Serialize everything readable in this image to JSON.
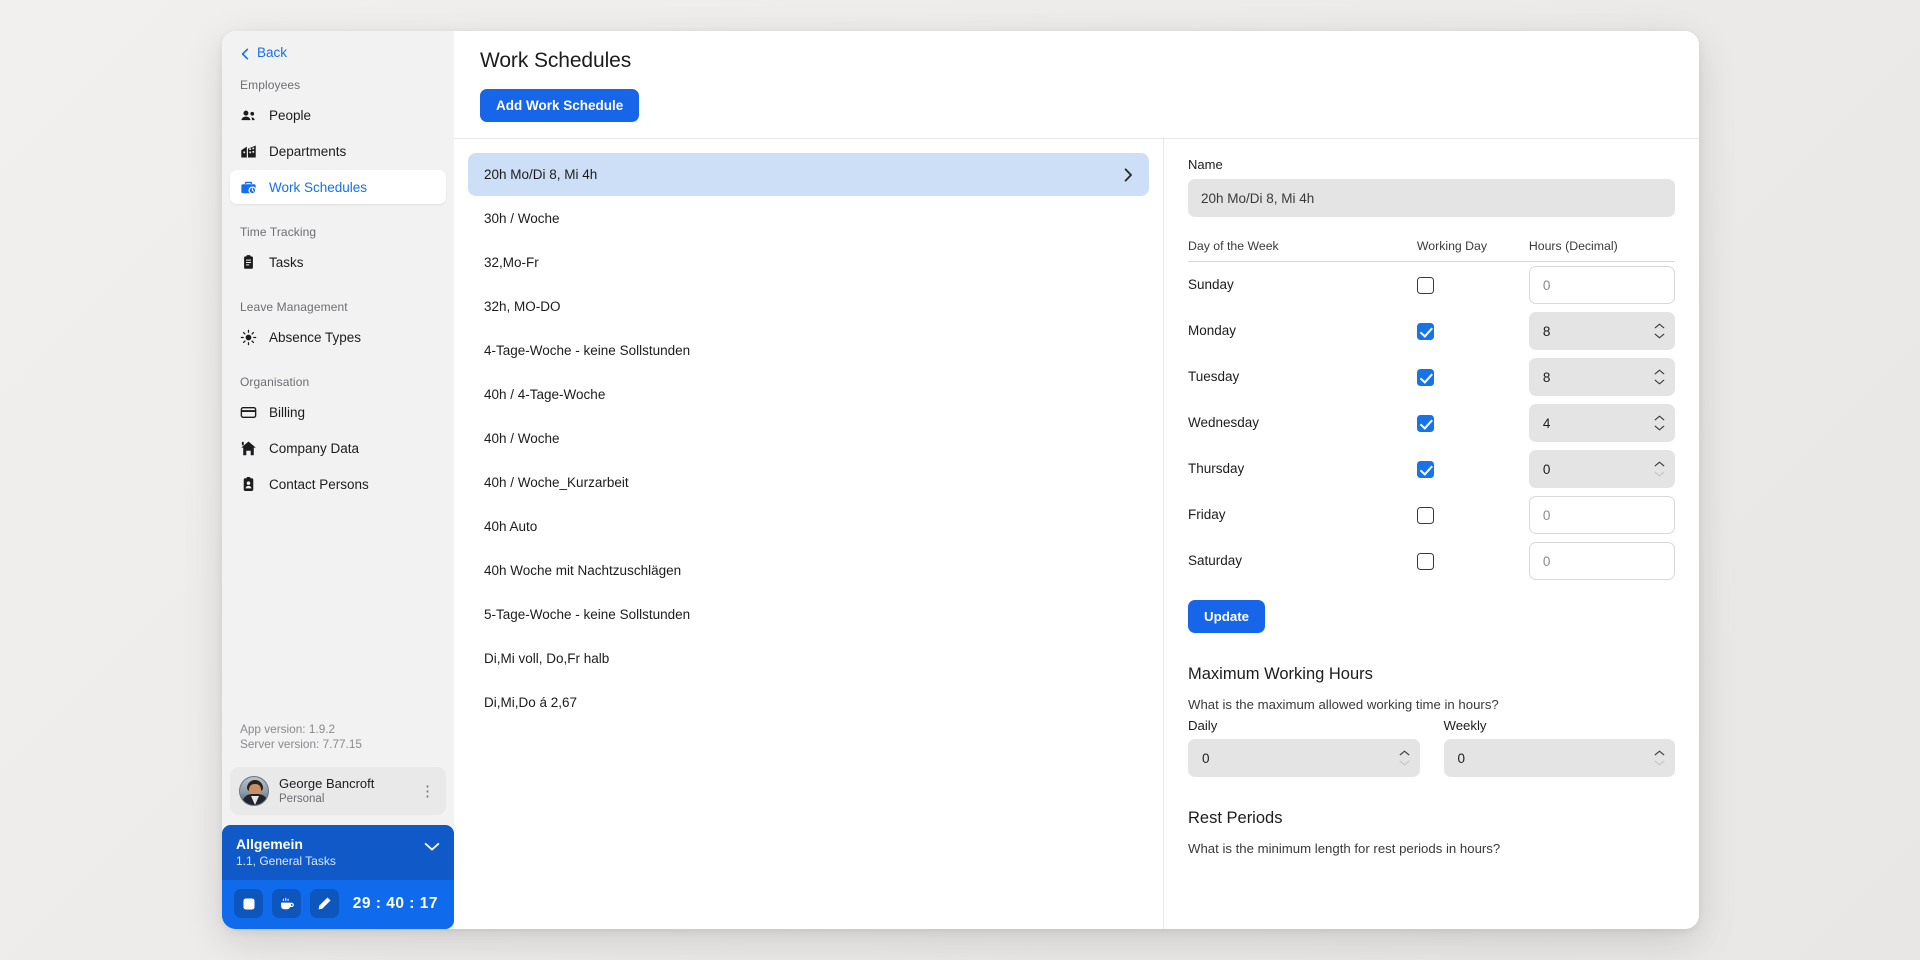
{
  "sidebar": {
    "back_label": "Back",
    "back_icon": "chevron-left-icon",
    "sections": [
      {
        "title": "Employees",
        "items": [
          {
            "label": "People",
            "icon": "people-icon",
            "active": false
          },
          {
            "label": "Departments",
            "icon": "department-building-icon",
            "active": false
          },
          {
            "label": "Work Schedules",
            "icon": "briefcase-clock-icon",
            "active": true
          }
        ]
      },
      {
        "title": "Time Tracking",
        "items": [
          {
            "label": "Tasks",
            "icon": "clipboard-icon",
            "active": false
          }
        ]
      },
      {
        "title": "Leave Management",
        "items": [
          {
            "label": "Absence Types",
            "icon": "sun-icon",
            "active": false
          }
        ]
      },
      {
        "title": "Organisation",
        "items": [
          {
            "label": "Billing",
            "icon": "credit-card-icon",
            "active": false
          },
          {
            "label": "Company Data",
            "icon": "home-icon",
            "active": false
          },
          {
            "label": "Contact Persons",
            "icon": "contact-badge-icon",
            "active": false
          }
        ]
      }
    ],
    "app_version": "App version: 1.9.2",
    "server_version": "Server version: 7.77.15",
    "user": {
      "name": "George Bancroft",
      "subtitle": "Personal",
      "menu_icon": "kebab-menu-icon",
      "avatar": "user-avatar"
    },
    "timer": {
      "project": "Allgemein",
      "task": "1.1, General Tasks",
      "expand_icon": "chevron-down-icon",
      "buttons": [
        {
          "name": "stop-button",
          "icon": "stop-square-icon"
        },
        {
          "name": "break-button",
          "icon": "coffee-cup-icon"
        },
        {
          "name": "edit-button",
          "icon": "pencil-icon"
        }
      ],
      "elapsed": "29 : 40 : 17"
    }
  },
  "header": {
    "title": "Work Schedules",
    "add_button": "Add Work Schedule"
  },
  "list": {
    "items": [
      {
        "label": "20h Mo/Di 8, Mi 4h",
        "selected": true
      },
      {
        "label": "30h / Woche",
        "selected": false
      },
      {
        "label": "32,Mo-Fr",
        "selected": false
      },
      {
        "label": "32h, MO-DO",
        "selected": false
      },
      {
        "label": "4-Tage-Woche - keine Sollstunden",
        "selected": false
      },
      {
        "label": "40h / 4-Tage-Woche",
        "selected": false
      },
      {
        "label": "40h / Woche",
        "selected": false
      },
      {
        "label": "40h / Woche_Kurzarbeit",
        "selected": false
      },
      {
        "label": "40h Auto",
        "selected": false
      },
      {
        "label": "40h Woche mit Nachtzuschlägen",
        "selected": false
      },
      {
        "label": "5-Tage-Woche - keine Sollstunden",
        "selected": false
      },
      {
        "label": "Di,Mi voll, Do,Fr halb",
        "selected": false
      },
      {
        "label": "Di,Mi,Do á 2,67",
        "selected": false
      }
    ],
    "chevron_icon": "chevron-right-icon"
  },
  "detail": {
    "name_label": "Name",
    "name_value": "20h Mo/Di 8, Mi 4h",
    "table": {
      "headers": [
        "Day of the Week",
        "Working Day",
        "Hours (Decimal)"
      ],
      "rows": [
        {
          "day": "Sunday",
          "working": false,
          "hours": "0",
          "filled": false
        },
        {
          "day": "Monday",
          "working": true,
          "hours": "8",
          "filled": true
        },
        {
          "day": "Tuesday",
          "working": true,
          "hours": "8",
          "filled": true
        },
        {
          "day": "Wednesday",
          "working": true,
          "hours": "4",
          "filled": true
        },
        {
          "day": "Thursday",
          "working": true,
          "hours": "0",
          "filled": true
        },
        {
          "day": "Friday",
          "working": false,
          "hours": "0",
          "filled": false
        },
        {
          "day": "Saturday",
          "working": false,
          "hours": "0",
          "filled": false
        }
      ]
    },
    "update_button": "Update",
    "max_hours": {
      "title": "Maximum Working Hours",
      "question": "What is the maximum allowed working time in hours?",
      "daily_label": "Daily",
      "daily_value": "0",
      "weekly_label": "Weekly",
      "weekly_value": "0"
    },
    "rest_periods": {
      "title": "Rest Periods",
      "question": "What is the minimum length for rest periods in hours?"
    }
  },
  "colors": {
    "accent": "#1765e8",
    "selected_row": "#cddff6",
    "sidebar_bg": "#f2f2f2",
    "timer_bg": "#0f6bec"
  }
}
